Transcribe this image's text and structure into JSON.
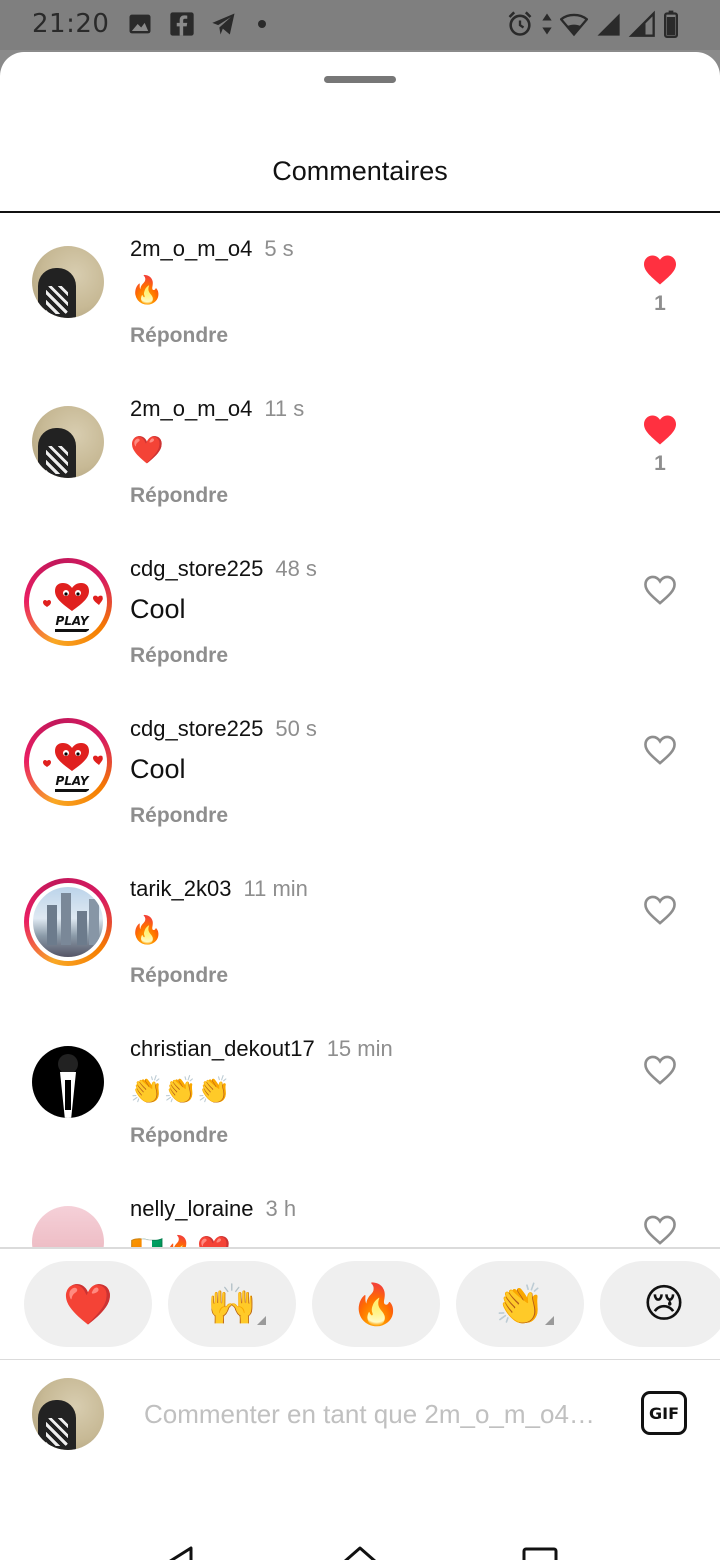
{
  "status_bar": {
    "time": "21:20",
    "left_icons": [
      "image-icon",
      "facebook-icon",
      "telegram-icon",
      "dot-icon"
    ],
    "right_icons": [
      "alarm-icon",
      "data-arrows-icon",
      "wifi-icon",
      "signal-icon",
      "signal-icon-2",
      "battery-icon"
    ]
  },
  "sheet": {
    "title": "Commentaires"
  },
  "comments": [
    {
      "username": "2m_o_m_o4",
      "time": "5 s",
      "text": "🔥",
      "reply": "Répondre",
      "liked": true,
      "likes": "1",
      "avatar": "desert"
    },
    {
      "username": "2m_o_m_o4",
      "time": "11 s",
      "text": "❤️",
      "reply": "Répondre",
      "liked": true,
      "likes": "1",
      "avatar": "desert"
    },
    {
      "username": "cdg_store225",
      "time": "48 s",
      "text": "Cool",
      "reply": "Répondre",
      "liked": false,
      "likes": "",
      "avatar": "play"
    },
    {
      "username": "cdg_store225",
      "time": "50 s",
      "text": "Cool",
      "reply": "Répondre",
      "liked": false,
      "likes": "",
      "avatar": "play"
    },
    {
      "username": "tarik_2k03",
      "time": "11 min",
      "text": "🔥",
      "reply": "Répondre",
      "liked": false,
      "likes": "",
      "avatar": "city"
    },
    {
      "username": "christian_dekout17",
      "time": "15 min",
      "text": "👏👏👏",
      "reply": "Répondre",
      "liked": false,
      "likes": "",
      "avatar": "suit"
    },
    {
      "username": "nelly_loraine",
      "time": "3 h",
      "text": "🇨🇮🔥❤️",
      "reply": "",
      "liked": false,
      "likes": "",
      "avatar": "hat"
    }
  ],
  "reactions": [
    {
      "emoji": "❤️",
      "name": "heart",
      "has_variants": false
    },
    {
      "emoji": "🙌",
      "name": "raised-hands",
      "has_variants": true
    },
    {
      "emoji": "🔥",
      "name": "fire",
      "has_variants": false
    },
    {
      "emoji": "👏",
      "name": "clap",
      "has_variants": true
    },
    {
      "emoji": "😢",
      "name": "crying",
      "has_variants": false
    }
  ],
  "input": {
    "placeholder": "Commenter en tant que 2m_o_m_o4…",
    "gif_label": "GIF"
  },
  "colors": {
    "like_red": "#ff3040",
    "muted_text": "#8e8e8e"
  }
}
